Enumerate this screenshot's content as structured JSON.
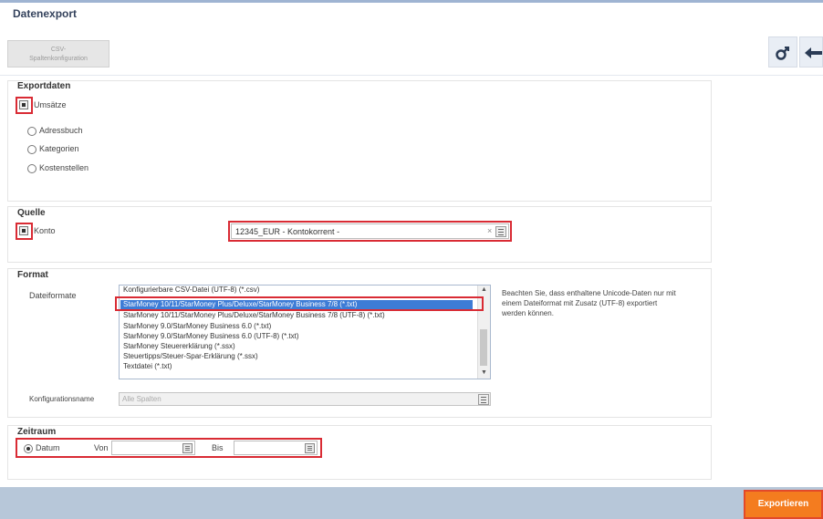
{
  "window": {
    "title": "Datenexport"
  },
  "toolbar": {
    "csv_button_line1": "CSV-",
    "csv_button_line2": "Spaltenkonfiguration",
    "settings_icon": "gender-symbol-icon",
    "back_icon": "arrow-left-icon"
  },
  "exportdaten": {
    "title": "Exportdaten",
    "items": [
      {
        "label": "Umsätze",
        "checked": true
      },
      {
        "label": "Adressbuch",
        "checked": false
      },
      {
        "label": "Kategorien",
        "checked": false
      },
      {
        "label": "Kostenstellen",
        "checked": false
      }
    ]
  },
  "quelle": {
    "title": "Quelle",
    "konto_label": "Konto",
    "konto_value": "12345_EUR - Kontokorrent -"
  },
  "format": {
    "title": "Format",
    "dateiformate_label": "Dateiformate",
    "options": [
      "Konfigurierbare CSV-Datei (UTF-8) (*.csv)",
      "StarMoney 10/11/StarMoney Plus/Deluxe/StarMoney Business 7/8 (*.txt)",
      "StarMoney 10/11/StarMoney Plus/Deluxe/StarMoney Business 7/8 (UTF-8) (*.txt)",
      "StarMoney 9.0/StarMoney Business 6.0 (*.txt)",
      "StarMoney 9.0/StarMoney Business 6.0 (UTF-8) (*.txt)",
      "StarMoney Steuererklärung (*.ssx)",
      "Steuertipps/Steuer-Spar-Erklärung (*.ssx)",
      "Textdatei (*.txt)"
    ],
    "selected_index": 1,
    "note": "Beachten Sie, dass enthaltene Unicode-Daten nur mit einem Dateiformat mit Zusatz (UTF-8) exportiert werden können.",
    "konfig_label": "Konfigurationsname",
    "konfig_value": "Alle Spalten"
  },
  "zeitraum": {
    "title": "Zeitraum",
    "datum_label": "Datum",
    "von_label": "Von",
    "bis_label": "Bis",
    "von_value": "",
    "bis_value": ""
  },
  "footer": {
    "export_label": "Exportieren"
  },
  "colors": {
    "accent": "#f47c1f",
    "highlight": "#d92b34",
    "selection": "#3d7cd6",
    "footer": "#b7c7d9"
  }
}
